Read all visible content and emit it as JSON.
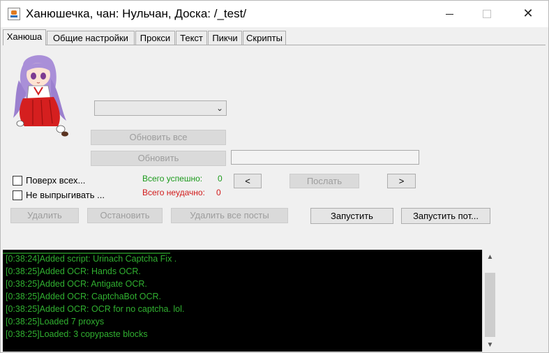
{
  "window": {
    "title": "Ханюшечка, чан: Нульчан, Доска: /_test/",
    "controls": {
      "minimize": "minimize-icon",
      "maximize": "maximize-icon",
      "close": "close-icon"
    }
  },
  "tabs": [
    {
      "label": "Ханюша",
      "active": true
    },
    {
      "label": "Общие настройки",
      "active": false
    },
    {
      "label": "Прокси",
      "active": false
    },
    {
      "label": "Текст",
      "active": false
    },
    {
      "label": "Пикчи",
      "active": false
    },
    {
      "label": "Скрипты",
      "active": false
    }
  ],
  "main": {
    "board_select": {
      "value": ""
    },
    "refresh_all_label": "Обновить все",
    "refresh_label": "Обновить",
    "thread_field": {
      "value": ""
    },
    "checkboxes": [
      {
        "label": "Поверх всех...",
        "checked": false
      },
      {
        "label": "Не выпрыгивать ...",
        "checked": false
      }
    ],
    "stats": {
      "success_label": "Всего успешно:",
      "success_count": "0",
      "fail_label": "Всего неудачно:",
      "fail_count": "0"
    },
    "prev_label": "<",
    "send_label": "Послать",
    "next_label": ">",
    "delete_label": "Удалить",
    "stop_label": "Остановить",
    "delete_all_label": "Удалить все посты",
    "start_label": "Запустить",
    "start_thread_label": "Запустить пот..."
  },
  "log": {
    "lines": [
      "[0:38:24]Added script: Urinach Captcha Fix .",
      "[0:38:25]Added OCR: Hands OCR.",
      "[0:38:25]Added OCR: Antigate OCR.",
      "[0:38:25]Added OCR: CaptchaBot OCR.",
      "[0:38:25]Added OCR: OCR for no captcha. lol.",
      "[0:38:25]Loaded 7 proxys",
      "[0:38:25]Loaded: 3 copypaste blocks"
    ]
  },
  "colors": {
    "success": "#1c9a1c",
    "fail": "#d11a1a",
    "log_text": "#30b030",
    "log_background": "#000000"
  }
}
